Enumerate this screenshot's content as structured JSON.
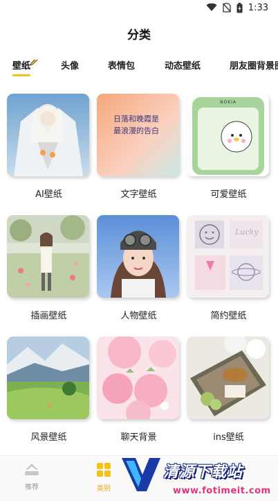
{
  "status_bar": {
    "time": "1:33"
  },
  "header": {
    "title": "分类"
  },
  "tabs": [
    {
      "label": "壁纸"
    },
    {
      "label": "头像"
    },
    {
      "label": "表情包"
    },
    {
      "label": "动态壁纸"
    },
    {
      "label": "朋友圈背景图"
    }
  ],
  "categories": [
    {
      "label": "AI壁纸",
      "thumb_text": ""
    },
    {
      "label": "文字壁纸",
      "thumb_text": "日落和晚霞是最浪漫的告白"
    },
    {
      "label": "可爱壁纸",
      "thumb_text": "NOKIA"
    },
    {
      "label": "插画壁纸",
      "thumb_text": ""
    },
    {
      "label": "人物壁纸",
      "thumb_text": ""
    },
    {
      "label": "简约壁纸",
      "thumb_text": "Lucky"
    },
    {
      "label": "风景壁纸",
      "thumb_text": ""
    },
    {
      "label": "聊天背景",
      "thumb_text": ""
    },
    {
      "label": "ins壁纸",
      "thumb_text": ""
    }
  ],
  "bottom_nav": [
    {
      "label": "推荐",
      "icon": "recommend-icon"
    },
    {
      "label": "类别",
      "icon": "category-icon"
    }
  ],
  "watermark": {
    "title": "清源下载站",
    "url": "www.fotimeit.com"
  },
  "colors": {
    "accent": "#f5c218",
    "text": "#111111"
  }
}
